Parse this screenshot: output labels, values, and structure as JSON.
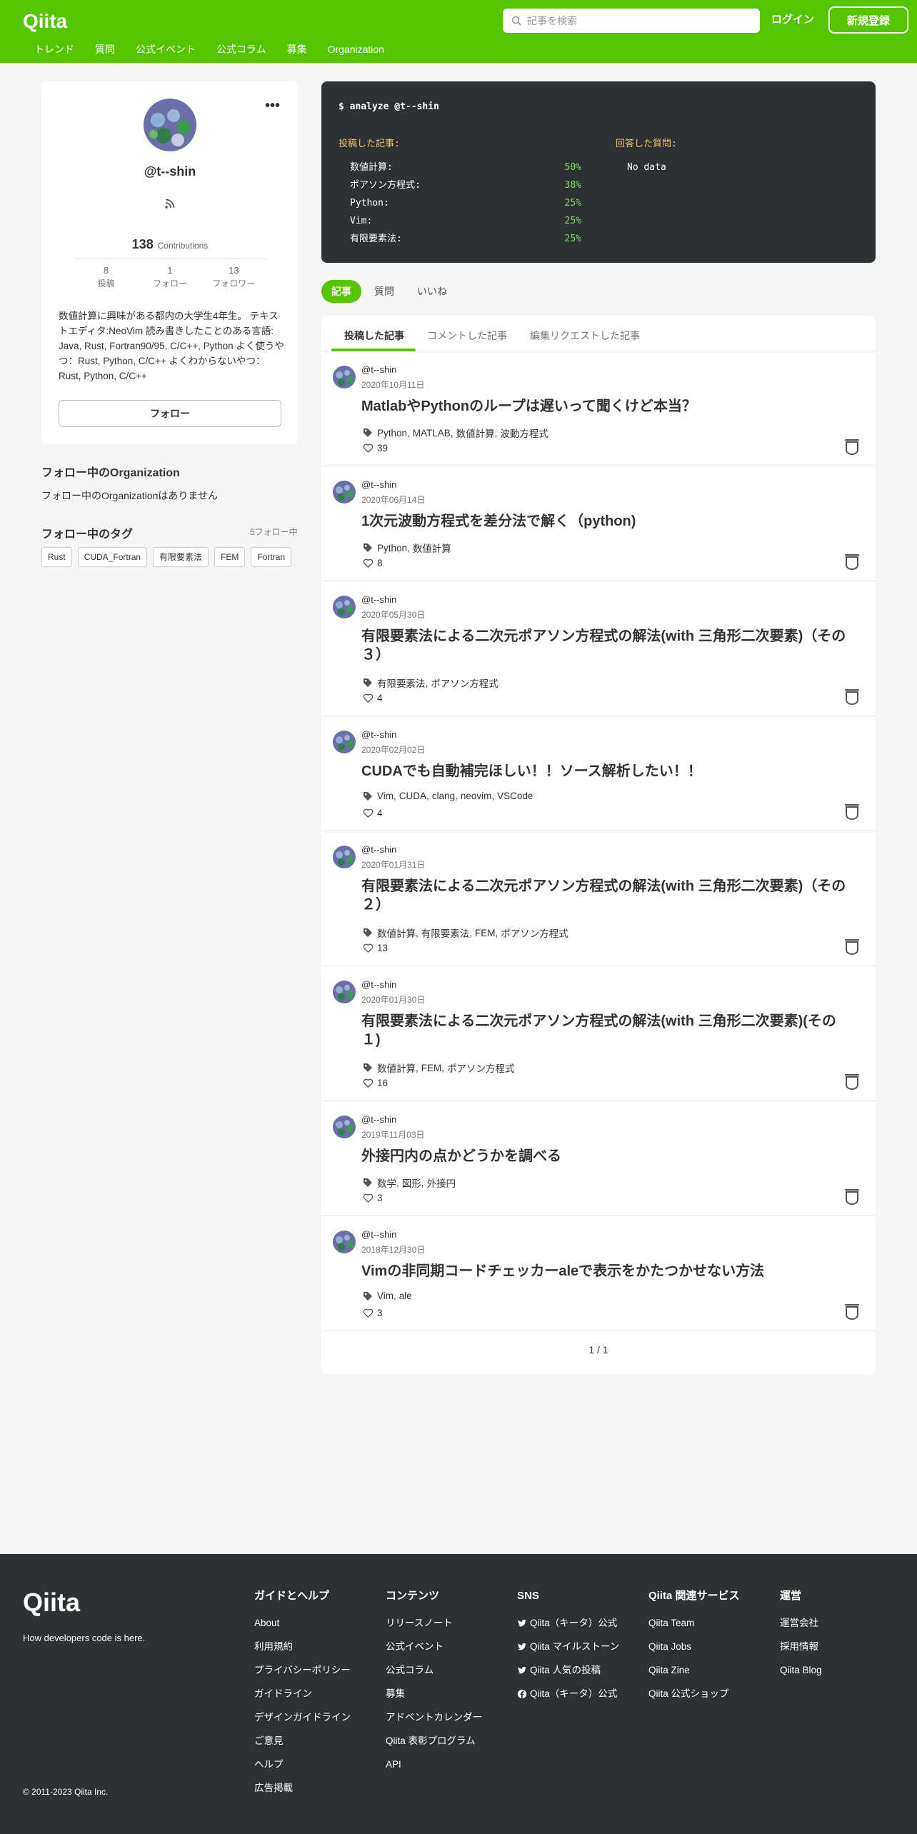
{
  "header": {
    "logo": "Qiita",
    "search_placeholder": "記事を検索",
    "login": "ログイン",
    "signup": "新規登録",
    "nav": [
      "トレンド",
      "質問",
      "公式イベント",
      "公式コラム",
      "募集",
      "Organization"
    ],
    "brand_color": "#55c500"
  },
  "profile": {
    "username": "@t--shin",
    "contributions_count": "138",
    "contributions_label": "Contributions",
    "stats": [
      {
        "num": "8",
        "label": "投稿"
      },
      {
        "num": "1",
        "label": "フォロー"
      },
      {
        "num": "13",
        "label": "フォロワー"
      }
    ],
    "bio": "数値計算に興味がある都内の大学生4年生。 テキストエディタ:NeoVim 読み書きしたことのある言語: Java, Rust, Fortran90/95, C/C++, Python よく使うやつ：Rust, Python, C/C++ よくわからないやつ：Rust, Python, C/C++",
    "follow_button": "フォロー"
  },
  "organizations": {
    "title": "フォロー中のOrganization",
    "empty": "フォロー中のOrganizationはありません"
  },
  "followed_tags": {
    "title": "フォロー中のタグ",
    "count": "5フォロー中",
    "tags": [
      "Rust",
      "CUDA_Fortran",
      "有限要素法",
      "FEM",
      "Fortran"
    ]
  },
  "terminal": {
    "command": "$ analyze @t--shin",
    "posted_heading": "投稿した記事:",
    "answered_heading": "回答した質問:",
    "rows": [
      {
        "key": "数値計算:",
        "value": "50%"
      },
      {
        "key": "ポアソン方程式:",
        "value": "38%"
      },
      {
        "key": "Python:",
        "value": "25%"
      },
      {
        "key": "Vim:",
        "value": "25%"
      },
      {
        "key": "有限要素法:",
        "value": "25%"
      }
    ],
    "no_data": "No data"
  },
  "tabs": [
    "記事",
    "質問",
    "いいね"
  ],
  "subtabs": [
    "投稿した記事",
    "コメントした記事",
    "編集リクエストした記事"
  ],
  "articles": [
    {
      "user": "@t--shin",
      "date": "2020年10月11日",
      "title": "MatlabやPythonのループは遅いって聞くけど本当？",
      "tags": [
        "Python",
        "MATLAB",
        "数値計算",
        "波動方程式"
      ],
      "likes": "39"
    },
    {
      "user": "@t--shin",
      "date": "2020年06月14日",
      "title": "1次元波動方程式を差分法で解く（python)",
      "tags": [
        "Python",
        "数値計算"
      ],
      "likes": "8"
    },
    {
      "user": "@t--shin",
      "date": "2020年05月30日",
      "title": "有限要素法による二次元ポアソン方程式の解法(with 三角形二次要素)（その３）",
      "tags": [
        "有限要素法",
        "ポアソン方程式"
      ],
      "likes": "4"
    },
    {
      "user": "@t--shin",
      "date": "2020年02月02日",
      "title": "CUDAでも自動補完ほしい！！ソース解析したい！！",
      "tags": [
        "Vim",
        "CUDA",
        "clang",
        "neovim",
        "VSCode"
      ],
      "likes": "4"
    },
    {
      "user": "@t--shin",
      "date": "2020年01月31日",
      "title": "有限要素法による二次元ポアソン方程式の解法(with 三角形二次要素)（その２）",
      "tags": [
        "数値計算",
        "有限要素法",
        "FEM",
        "ポアソン方程式"
      ],
      "likes": "13"
    },
    {
      "user": "@t--shin",
      "date": "2020年01月30日",
      "title": "有限要素法による二次元ポアソン方程式の解法(with 三角形二次要素)(その１)",
      "tags": [
        "数値計算",
        "FEM",
        "ポアソン方程式"
      ],
      "likes": "16"
    },
    {
      "user": "@t--shin",
      "date": "2019年11月03日",
      "title": "外接円内の点かどうかを調べる",
      "tags": [
        "数学",
        "図形",
        "外接円"
      ],
      "likes": "3"
    },
    {
      "user": "@t--shin",
      "date": "2018年12月30日",
      "title": "Vimの非同期コードチェッカーaleで表示をかたつかせない方法",
      "tags": [
        "Vim",
        "ale"
      ],
      "likes": "3"
    }
  ],
  "pager": "1 / 1",
  "footer": {
    "logo": "Qiita",
    "tagline": "How developers code is here.",
    "copyright": "© 2011-2023 Qiita Inc.",
    "columns": [
      {
        "title": "ガイドとヘルプ",
        "links": [
          "About",
          "利用規約",
          "プライバシーポリシー",
          "ガイドライン",
          "デザインガイドライン",
          "ご意見",
          "ヘルプ",
          "広告掲載"
        ]
      },
      {
        "title": "コンテンツ",
        "links": [
          "リリースノート",
          "公式イベント",
          "公式コラム",
          "募集",
          "アドベントカレンダー",
          "Qiita 表彰プログラム",
          "API"
        ]
      },
      {
        "title": "SNS",
        "links": [
          "Qiita（キータ）公式",
          "Qiita マイルストーン",
          "Qiita 人気の投稿",
          "Qiita（キータ）公式"
        ],
        "icons": [
          "twitter-icon",
          "twitter-icon",
          "twitter-icon",
          "facebook-icon"
        ]
      },
      {
        "title": "Qiita 関連サービス",
        "links": [
          "Qiita Team",
          "Qiita Jobs",
          "Qiita Zine",
          "Qiita 公式ショップ"
        ]
      },
      {
        "title": "運営",
        "links": [
          "運営会社",
          "採用情報",
          "Qiita Blog"
        ]
      }
    ]
  }
}
